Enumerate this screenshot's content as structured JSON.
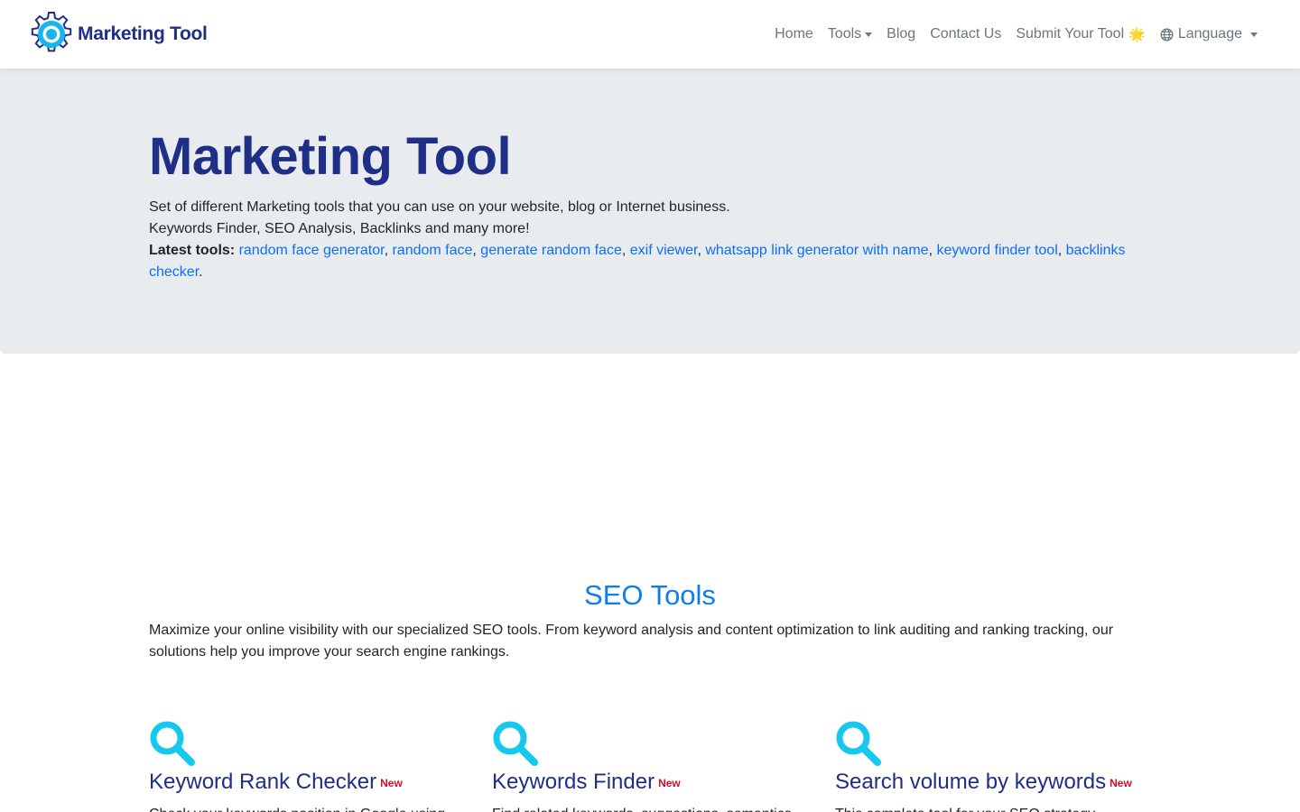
{
  "navbar": {
    "brand_name": "Marketing Tool",
    "items": [
      {
        "label": "Home"
      },
      {
        "label": "Tools"
      },
      {
        "label": "Blog"
      },
      {
        "label": "Contact Us"
      },
      {
        "label": "Submit Your Tool"
      },
      {
        "label": "Language"
      }
    ],
    "submit_emoji": "🌟"
  },
  "hero": {
    "title": "Marketing Tool",
    "line1": "Set of different Marketing tools that you can use on your website, blog or Internet business.",
    "line2": "Keywords Finder, SEO Analysis, Backlinks and many more!",
    "latest_label": "Latest tools:",
    "latest_links": [
      "random face generator",
      "random face",
      "generate random face",
      "exif viewer",
      "whatsapp link generator with name",
      "keyword finder tool",
      "backlinks checker"
    ]
  },
  "seo": {
    "title": "SEO Tools",
    "description": "Maximize your online visibility with our specialized SEO tools. From keyword analysis and content optimization to link auditing and ranking tracking, our solutions help you improve your search engine rankings.",
    "cards": [
      {
        "title": "Keyword Rank Checker",
        "badge": "New",
        "description": "Check your keywords position in Google using"
      },
      {
        "title": "Keywords Finder",
        "badge": "New",
        "description": "Find related keywords, suggestions, semantics"
      },
      {
        "title": "Search volume by keywords",
        "badge": "New",
        "description": "This complete tool for your SEO strategy"
      }
    ]
  },
  "colors": {
    "brand": "#1f2e86",
    "link": "#0d6efd",
    "section_title": "#0d7df0",
    "icon": "#16c7ee",
    "badge": "#c8102e",
    "hero_bg": "#e9ecef"
  }
}
